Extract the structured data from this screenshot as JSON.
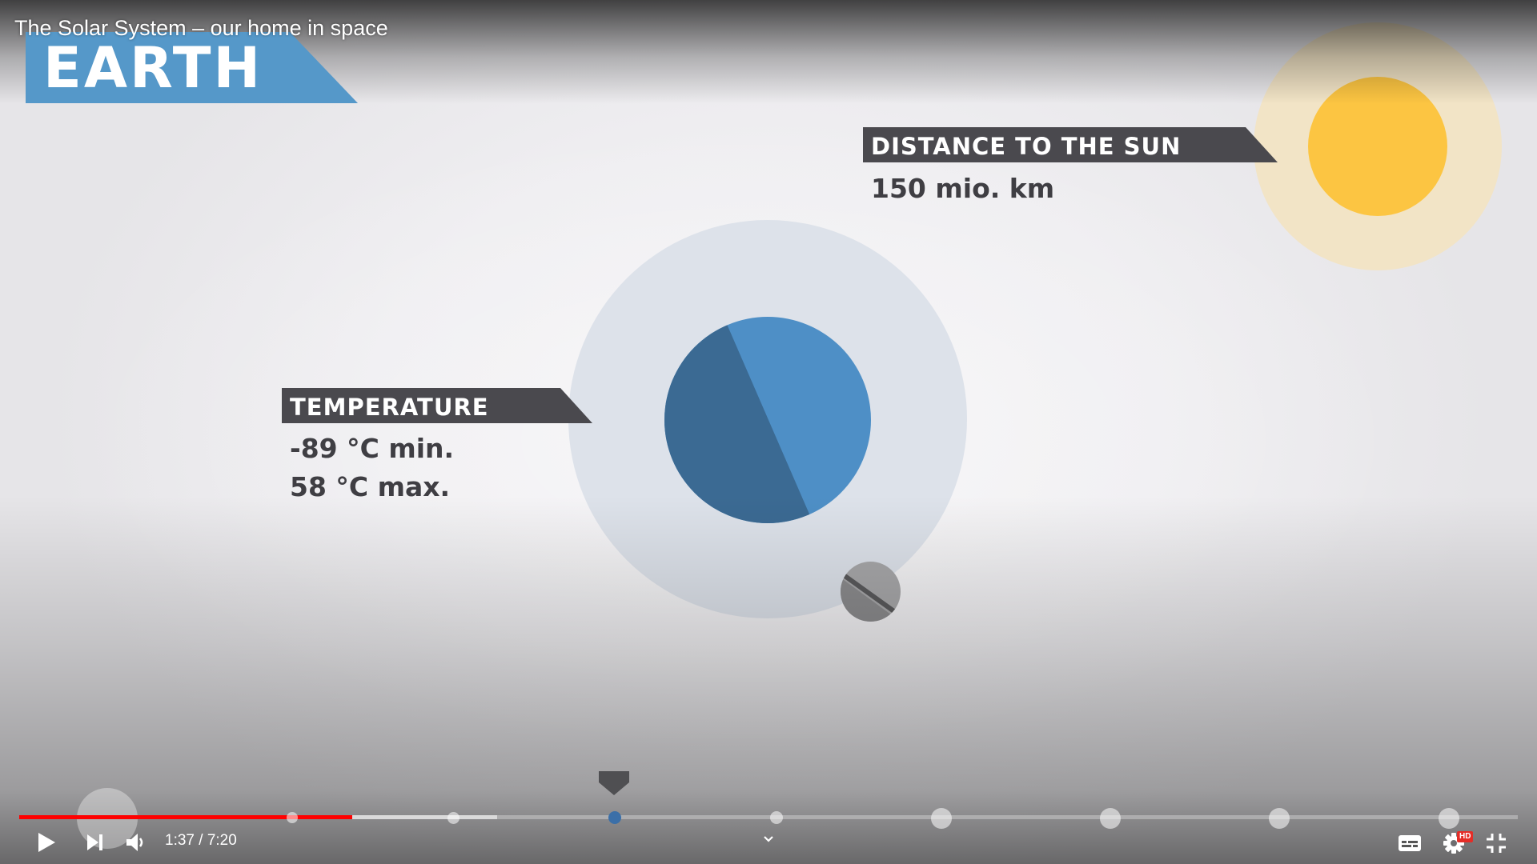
{
  "video": {
    "title": "The Solar System – our home in space"
  },
  "scene": {
    "planet_label": "EARTH",
    "distance": {
      "label": "DISTANCE TO THE SUN",
      "value": "150 mio. km"
    },
    "temperature": {
      "label": "TEMPERATURE",
      "min": "-89 °C min.",
      "max": "58 °C max."
    },
    "colors": {
      "banner_blue": "#5598c9",
      "tag_dark": "#4a494e",
      "sun": "#fcc542",
      "sun_halo": "#f2e4c6",
      "earth_light": "#4e8fc6",
      "earth_dark": "#3b6a93",
      "moon": "#9a9a9c"
    }
  },
  "player": {
    "time_display": "1:37 / 7:20",
    "played_fraction": 0.222,
    "buffered_fraction": 0.319,
    "progress_color": "#ff0000",
    "controls": {
      "play": "play-icon",
      "next": "next-icon",
      "volume": "volume-icon",
      "chapters": "chevron-down-icon",
      "subtitles": "subtitles-icon",
      "settings": "gear-icon",
      "settings_badge": "HD",
      "exit_fullscreen": "exit-fullscreen-icon"
    }
  }
}
